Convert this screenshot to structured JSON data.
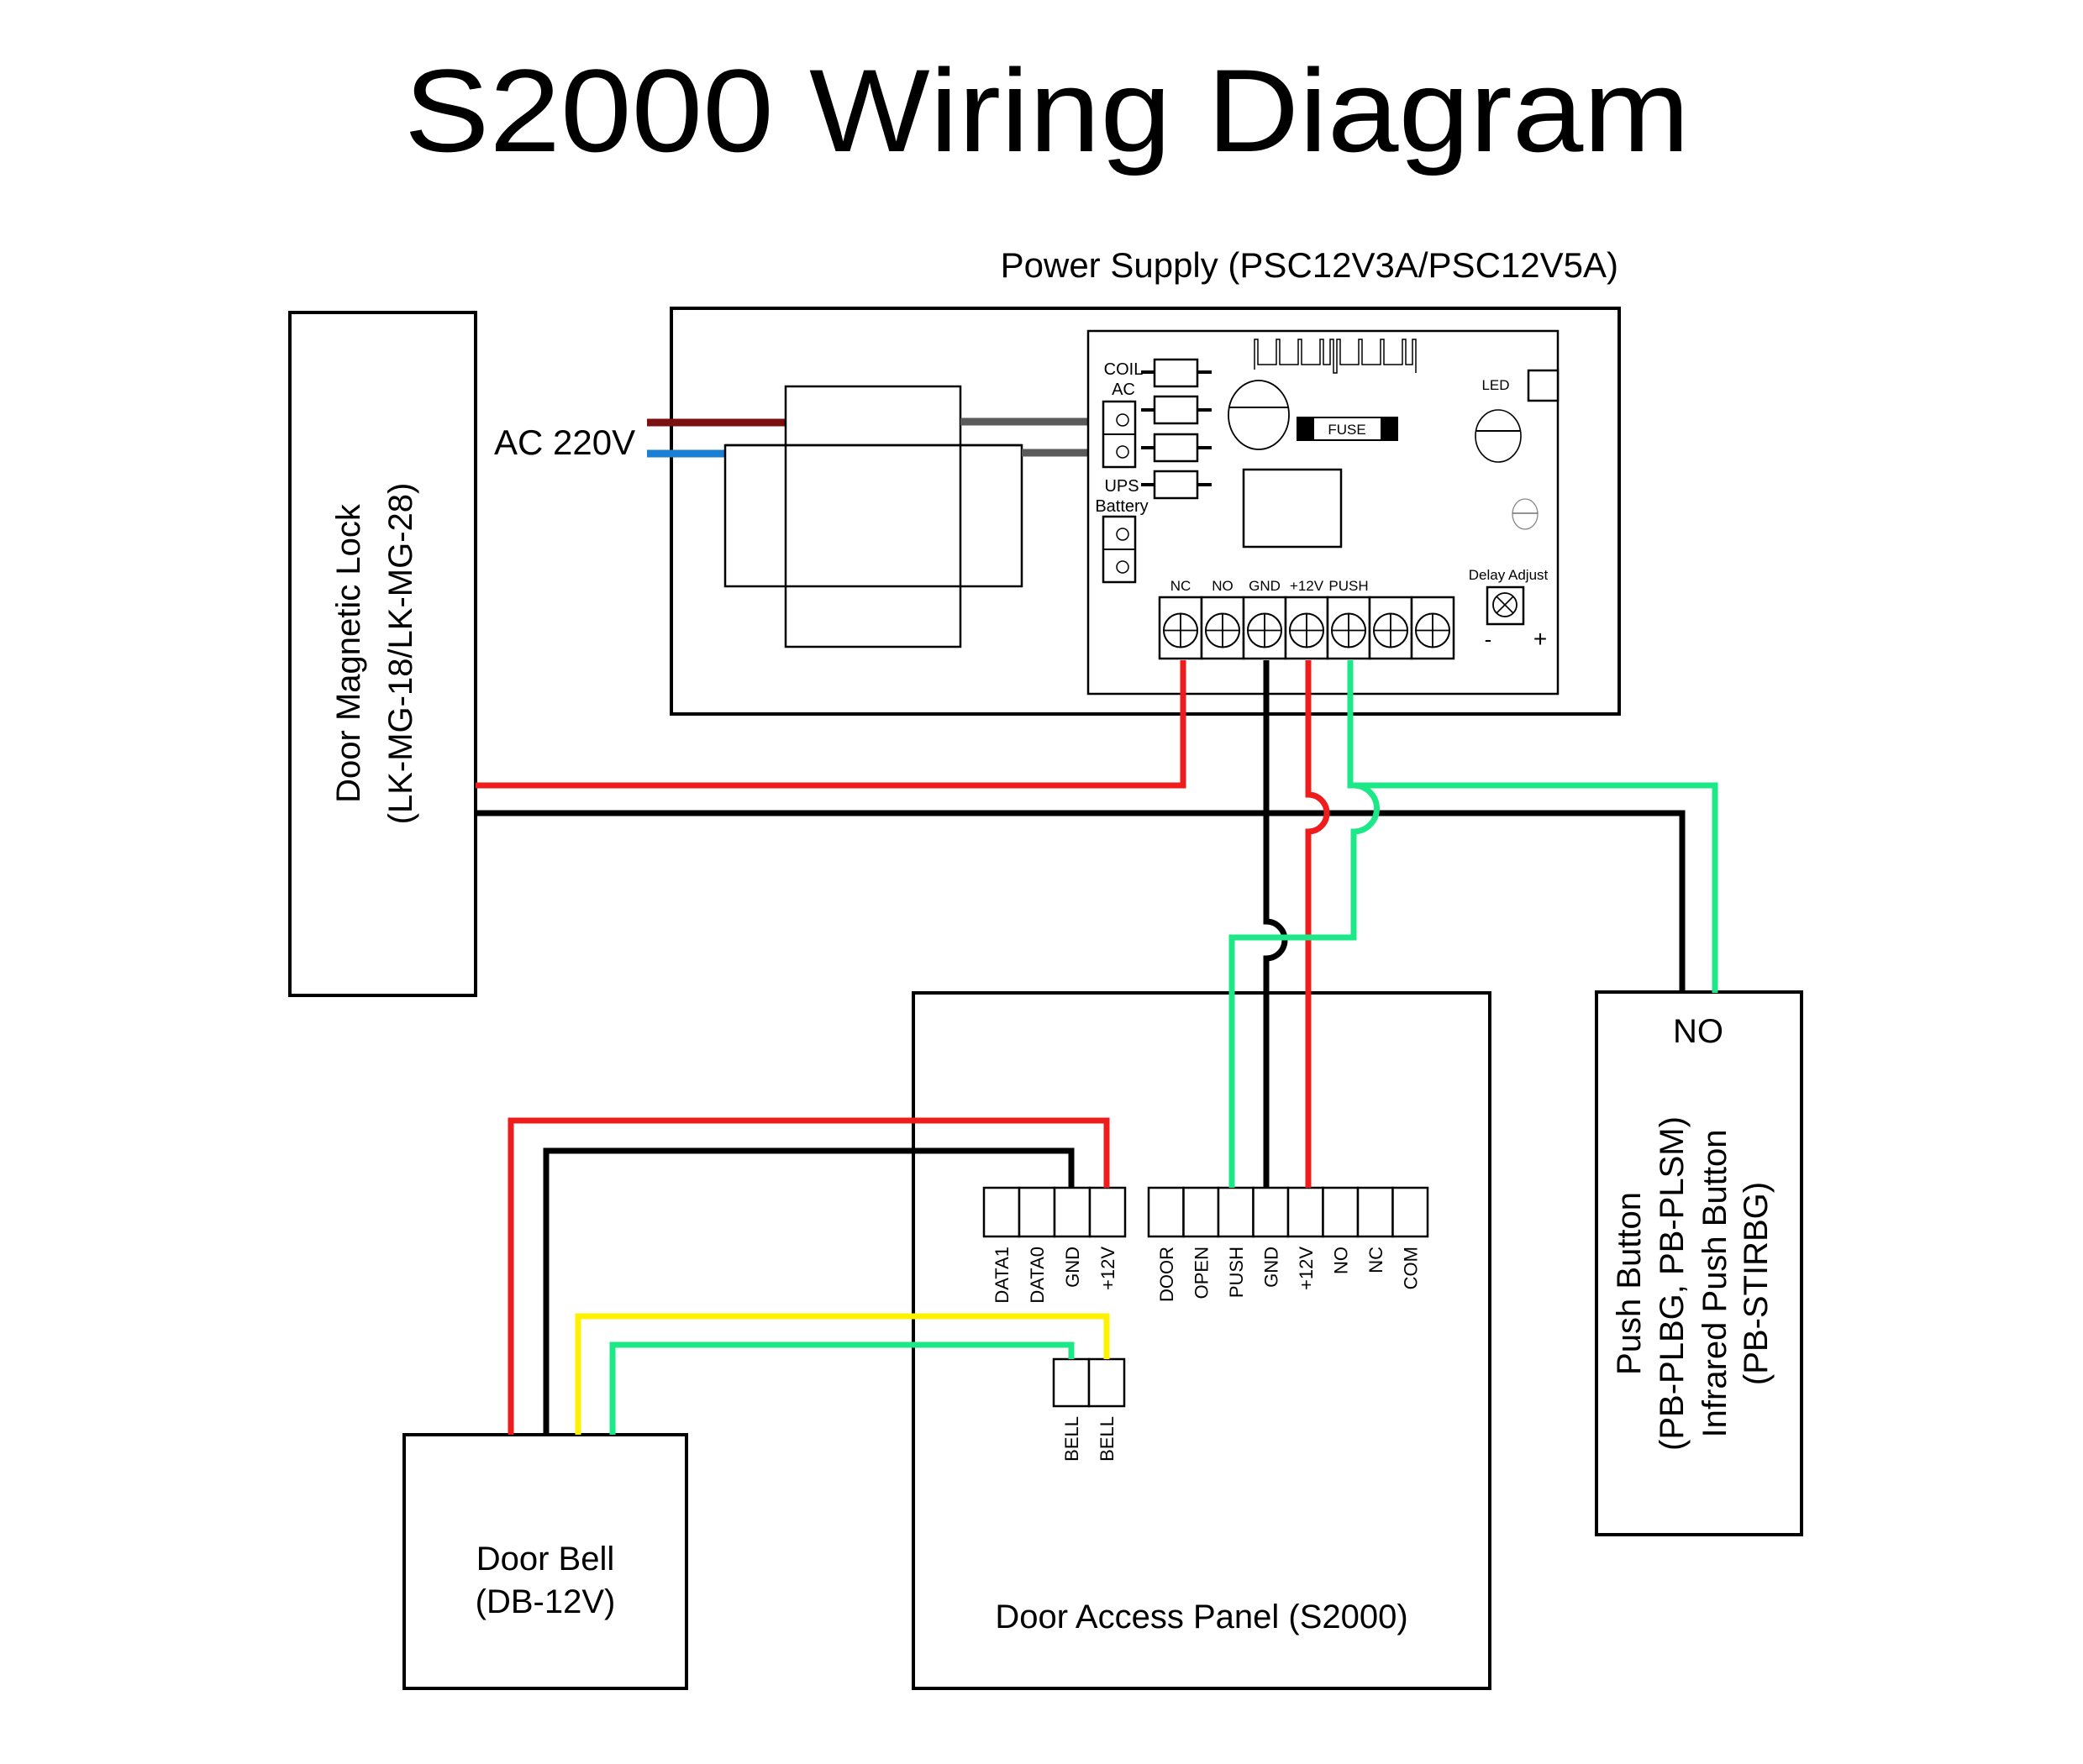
{
  "title": "S2000 Wiring Diagram",
  "colors": {
    "red": "#ee1c1c",
    "black": "#000000",
    "green": "#1de887",
    "yellow": "#fff200",
    "ac_live": "#7b1010",
    "ac_neutral": "#1b7fd4",
    "gray_wire": "#5a5a5a"
  },
  "power_supply": {
    "label": "Power Supply (PSC12V3A/PSC12V5A)",
    "ac_input_label": "AC 220V",
    "pcb": {
      "coil_ac_label_1": "COIL",
      "coil_ac_label_2": "AC",
      "ups_label_1": "UPS",
      "ups_label_2": "Battery",
      "led_label": "LED",
      "fuse_label": "FUSE",
      "delay_adjust_label": "Delay Adjust",
      "delay_minus": "-",
      "delay_plus": "+",
      "terminals": [
        "NC",
        "NO",
        "GND",
        "+12V",
        "PUSH",
        "",
        ""
      ]
    }
  },
  "door_lock": {
    "line1": "Door Magnetic Lock",
    "line2": "(LK-MG-18/LK-MG-28)"
  },
  "access_panel": {
    "label": "Door Access Panel (S2000)",
    "reader_terminals": [
      "DATA1",
      "DATA0",
      "GND",
      "+12V"
    ],
    "main_terminals": [
      "DOOR",
      "OPEN",
      "PUSH",
      "GND",
      "+12V",
      "NO",
      "NC",
      "COM"
    ],
    "bell_terminals": [
      "BELL",
      "BELL"
    ]
  },
  "door_bell": {
    "line1": "Door Bell",
    "line2": "(DB-12V)"
  },
  "push_button": {
    "terminal_label": "NO",
    "line1": "Push Button",
    "line2": "(PB-PLBG, PB-PLSM)",
    "line3": "Infrared Push Button",
    "line4": "(PB-STIRBG)"
  }
}
